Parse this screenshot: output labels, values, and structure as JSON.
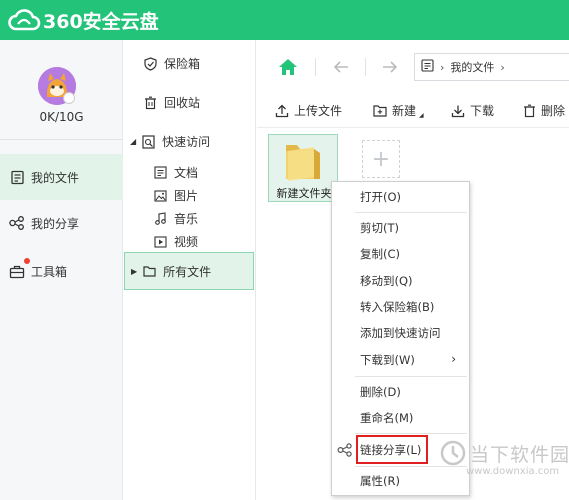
{
  "app": {
    "logo_text": "360安全云盘"
  },
  "sidebar": {
    "quota": "0K/10G",
    "items": [
      {
        "label": "我的文件",
        "icon": "file-icon"
      },
      {
        "label": "我的分享",
        "icon": "share-icon"
      },
      {
        "label": "工具箱",
        "icon": "toolbox-icon"
      }
    ]
  },
  "tree": {
    "items": [
      {
        "label": "保险箱",
        "icon": "shield-icon"
      },
      {
        "label": "回收站",
        "icon": "trash-icon"
      },
      {
        "label": "快速访问",
        "icon": "quick-access-icon"
      },
      {
        "label": "文档",
        "icon": "document-icon"
      },
      {
        "label": "图片",
        "icon": "image-icon"
      },
      {
        "label": "音乐",
        "icon": "music-icon"
      },
      {
        "label": "视频",
        "icon": "video-icon"
      },
      {
        "label": "所有文件",
        "icon": "folder-icon"
      }
    ]
  },
  "nav": {
    "path_root": "我的文件"
  },
  "toolbar": {
    "upload": "上传文件",
    "new": "新建",
    "download": "下载",
    "delete": "删除"
  },
  "files": [
    {
      "name": "新建文件夹",
      "type": "folder"
    }
  ],
  "context_menu": {
    "items": [
      {
        "label": "打开(O)"
      },
      {
        "label": "剪切(T)"
      },
      {
        "label": "复制(C)"
      },
      {
        "label": "移动到(Q)"
      },
      {
        "label": "转入保险箱(B)"
      },
      {
        "label": "添加到快速访问"
      },
      {
        "label": "下载到(W)"
      },
      {
        "label": "删除(D)"
      },
      {
        "label": "重命名(M)"
      },
      {
        "label": "链接分享(L)"
      },
      {
        "label": "属性(R)"
      }
    ]
  },
  "watermark": {
    "text": "当下软件园",
    "url": "www.downxia.com"
  },
  "colors": {
    "brand": "#24c37a",
    "active_bg": "#e2f4ea",
    "highlight": "#e02020"
  }
}
